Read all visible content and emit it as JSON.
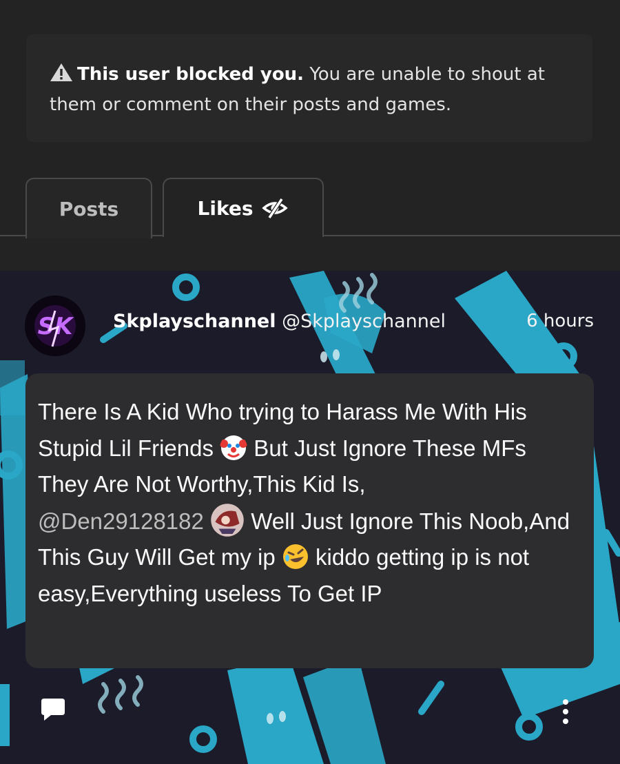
{
  "notice": {
    "icon": "warning-triangle-icon",
    "strong": "This user blocked you.",
    "text": " You are unable to shout at them or comment on their posts and games."
  },
  "tabs": [
    {
      "label": "Posts",
      "active": true
    },
    {
      "label": "Likes",
      "icon": "hidden-eye-icon",
      "active": false
    }
  ],
  "post": {
    "author_name": "Skplayschannel",
    "author_handle": "@Skplayschannel",
    "time": "6 hours",
    "body": {
      "part1": "There Is A Kid Who trying to Harass Me With His Stupid Lil Friends ",
      "part2": " But Just Ignore These MFs They Are Not Worthy,This Kid Is,",
      "mention": "@Den29128182",
      "part3": " Well Just Ignore This Noob,And This Guy Will Get my ip ",
      "part4": " kiddo getting ip is not easy,Everything useless To Get IP"
    },
    "emojis": [
      "clown-face-emoji",
      "mention-avatar-image",
      "rolling-laughing-emoji"
    ],
    "actions": [
      "comment-icon",
      "more-options-icon"
    ]
  },
  "colors": {
    "background": "#232323",
    "notice_bg": "#282828",
    "bubble_bg": "#2d2d2f",
    "pattern_accent": "#2aa7c7",
    "avatar_glow": "#b12cff"
  }
}
